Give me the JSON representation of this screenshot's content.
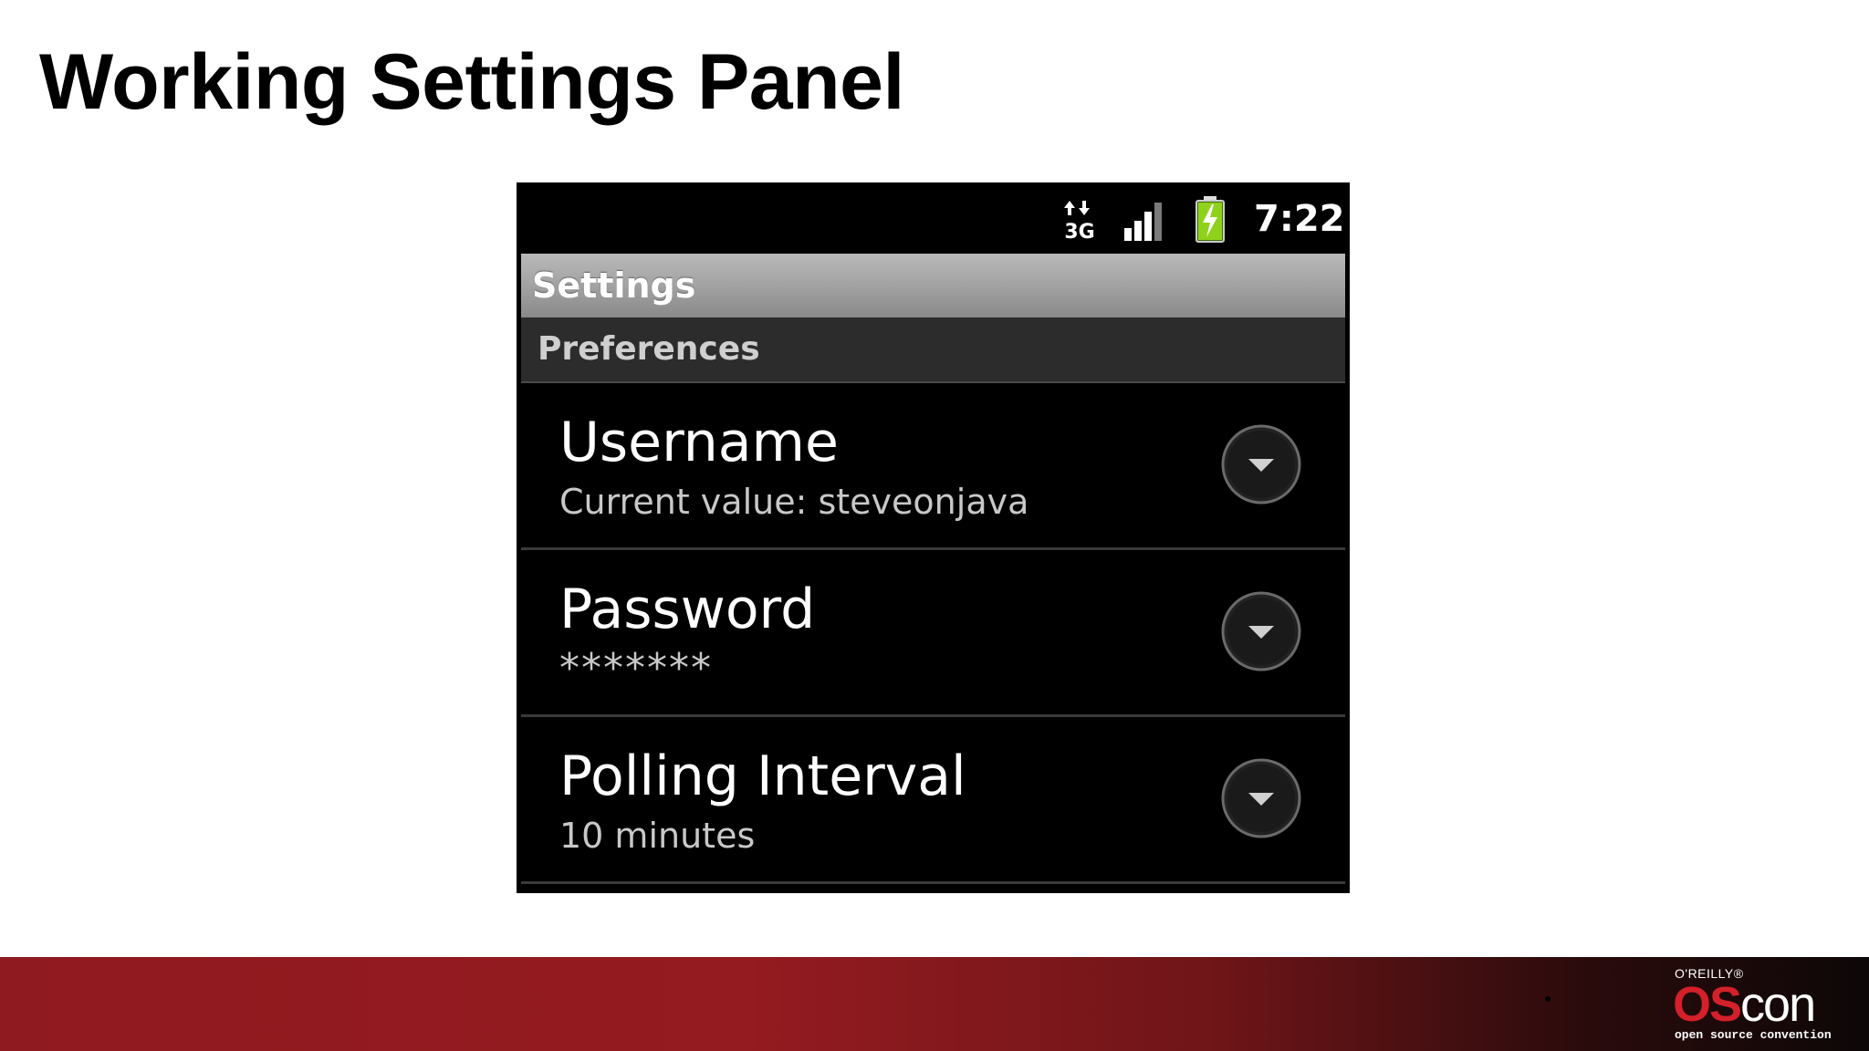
{
  "slide": {
    "title": "Working Settings Panel"
  },
  "phone": {
    "status_bar": {
      "network_icon": "3g-data-icon",
      "network_label": "3G",
      "signal_icon": "signal-strength-icon",
      "battery_icon": "battery-charging-icon",
      "time": "7:22"
    },
    "title_bar": {
      "title": "Settings"
    },
    "category": {
      "label": "Preferences"
    },
    "preferences": [
      {
        "title": "Username",
        "summary": "Current value: steveonjava",
        "action_icon": "dropdown-arrow-icon"
      },
      {
        "title": "Password",
        "summary": "*******",
        "action_icon": "dropdown-arrow-icon"
      },
      {
        "title": "Polling Interval",
        "summary": "10 minutes",
        "action_icon": "dropdown-arrow-icon"
      }
    ]
  },
  "footer": {
    "logo": {
      "publisher": "O'REILLY®",
      "brand_os": "OS",
      "brand_con": "con",
      "tagline": "open source convention"
    }
  },
  "colors": {
    "footer_red": "#941b20",
    "logo_red": "#d4202a",
    "battery_green": "#8fd21c",
    "title_bar_gray": "#a2a2a2",
    "category_bg": "#2c2c2c"
  }
}
